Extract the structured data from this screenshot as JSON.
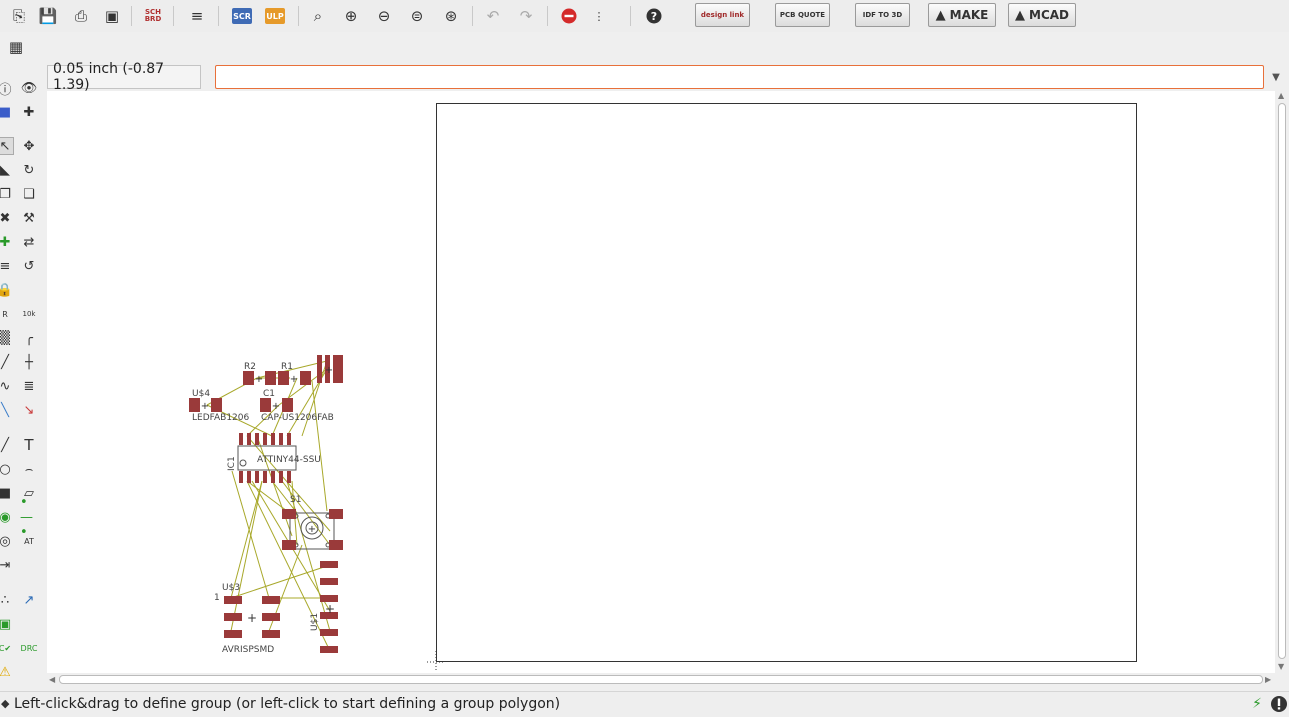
{
  "toolbar": {
    "icons": [
      "open-icon",
      "save-icon",
      "print-icon",
      "cam-icon",
      "sch-brd-icon",
      "library-icon",
      "script-icon",
      "ulp-icon",
      "zoom-fit-icon",
      "zoom-in-icon",
      "zoom-out-icon",
      "zoom-select-icon",
      "zoom-last-icon",
      "undo-icon",
      "redo-icon",
      "stop-icon",
      "go-icon",
      "help-icon"
    ],
    "sch_brd_label": "SCH\nBRD",
    "scr_label": "SCR",
    "ulp_label": "ULP",
    "designlink_label": "design link",
    "pcb_quote_label": "PCB QUOTE",
    "idf_label": "IDF TO 3D",
    "make_label": "MAKE",
    "mcad_label": "MCAD"
  },
  "coordinate_display": "0.05 inch (-0.87 1.39)",
  "command_line": {
    "value": "",
    "placeholder": ""
  },
  "board": {
    "parts": [
      {
        "ref": "R2"
      },
      {
        "ref": "R1"
      },
      {
        "ref": "U$4",
        "value": "LEDFAB1206"
      },
      {
        "ref": "C1",
        "value": "CAP-US1206FAB"
      },
      {
        "ref": "IC1",
        "value": "ATTINY44-SSU"
      },
      {
        "ref": "S1"
      },
      {
        "ref": "U$3",
        "value": "AVRISPSMD",
        "pin": "1"
      },
      {
        "ref": "U$1"
      }
    ]
  },
  "status": {
    "message": "Left-click&drag to define group (or left-click to start defining a group polygon)"
  },
  "colors": {
    "pad": "#9a3a3a",
    "airwire": "#a8a82a",
    "accent": "#e8703a"
  }
}
